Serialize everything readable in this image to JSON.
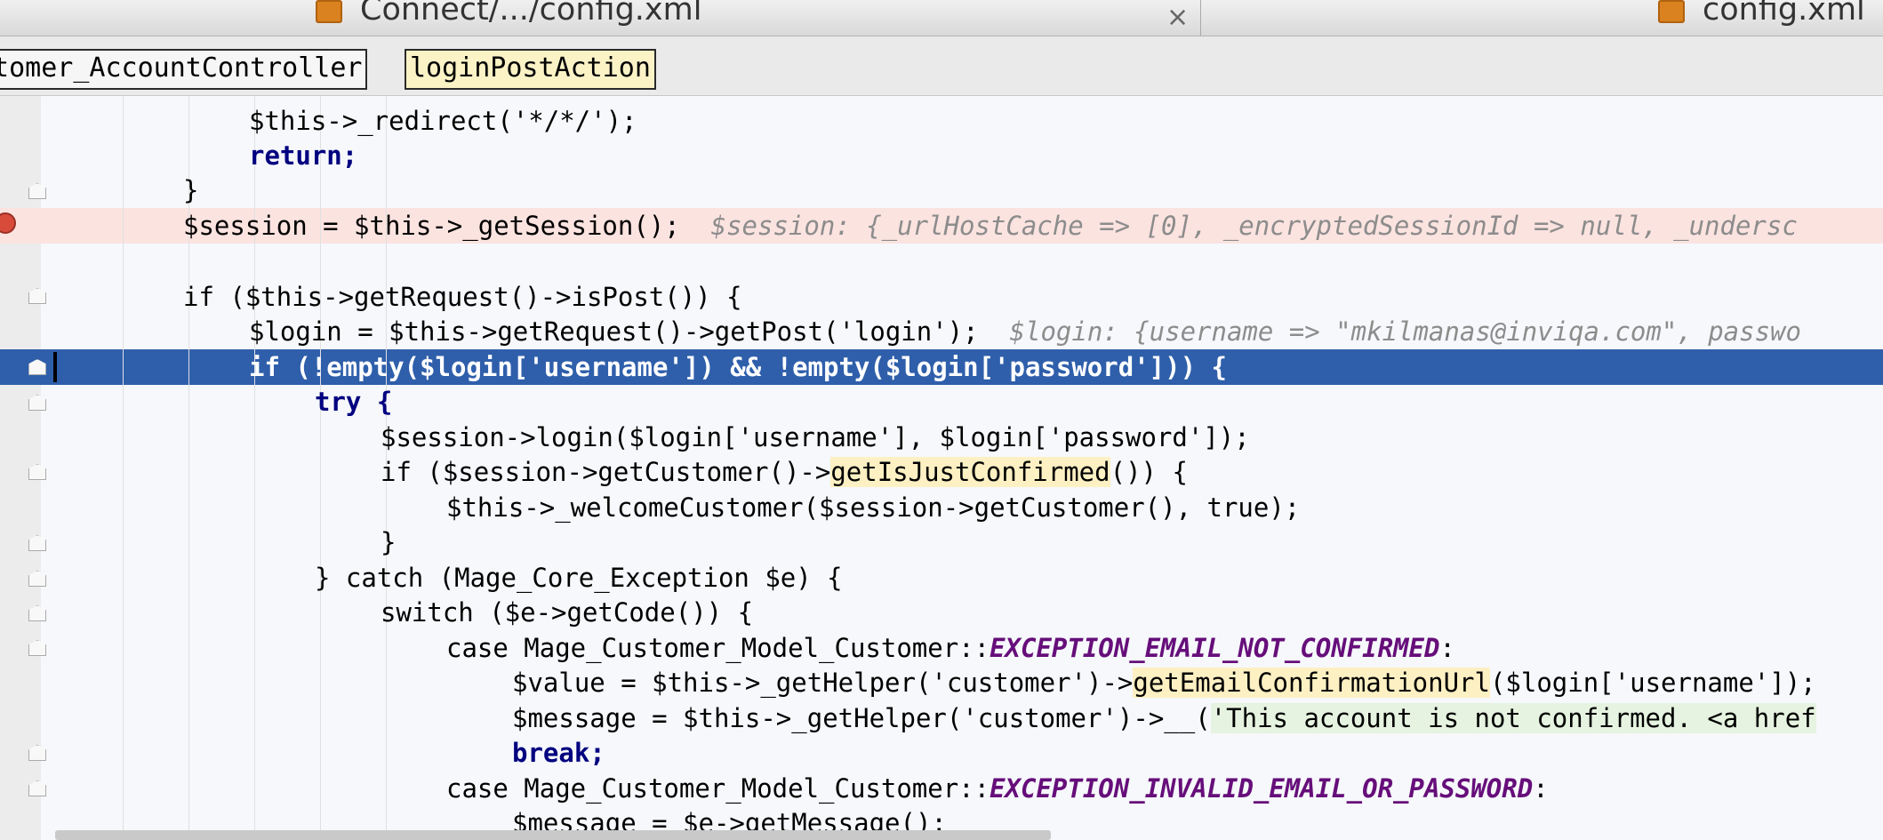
{
  "tabs": [
    {
      "label": "Connect/.../config.xml",
      "close": "×"
    },
    {
      "label": "config.xml"
    }
  ],
  "breadcrumb": [
    "stomer_AccountController",
    "loginPostAction"
  ],
  "code": {
    "l1": "$this->_redirect('*/*/');",
    "l2": "return;",
    "l3": "}",
    "l4_stmt": "$session = $this->_getSession();",
    "l4_hint": "$session: {_urlHostCache => [0], _encryptedSessionId => null, _undersc",
    "l6": "if ($this->getRequest()->isPost()) {",
    "l7_stmt": "$login = $this->getRequest()->getPost('login');",
    "l7_hint": "$login: {username => \"mkilmanas@inviqa.com\", passwo",
    "l8": "if (!empty($login['username']) && !empty($login['password'])) {",
    "l9": "try {",
    "l10": "$session->login($login['username'], $login['password']);",
    "l11a": "if ($session->getCustomer()->",
    "l11b": "getIsJustConfirmed",
    "l11c": "()) {",
    "l12": "$this->_welcomeCustomer($session->getCustomer(), true);",
    "l13": "}",
    "l14": "} catch (Mage_Core_Exception $e) {",
    "l15": "switch ($e->getCode()) {",
    "l16a": "case Mage_Customer_Model_Customer::",
    "l16b": "EXCEPTION_EMAIL_NOT_CONFIRMED",
    "l16c": ":",
    "l17a": "$value = $this->_getHelper('customer')->",
    "l17b": "getEmailConfirmationUrl",
    "l17c": "($login['username']);",
    "l18a": "$message = $this->_getHelper('customer')->__(",
    "l18b": "'This account is not confirmed. <a href",
    "l19": "break;",
    "l20a": "case Mage_Customer_Model_Customer::",
    "l20b": "EXCEPTION_INVALID_EMAIL_OR_PASSWORD",
    "l20c": ":",
    "l21": "$message = $e->getMessage();"
  }
}
